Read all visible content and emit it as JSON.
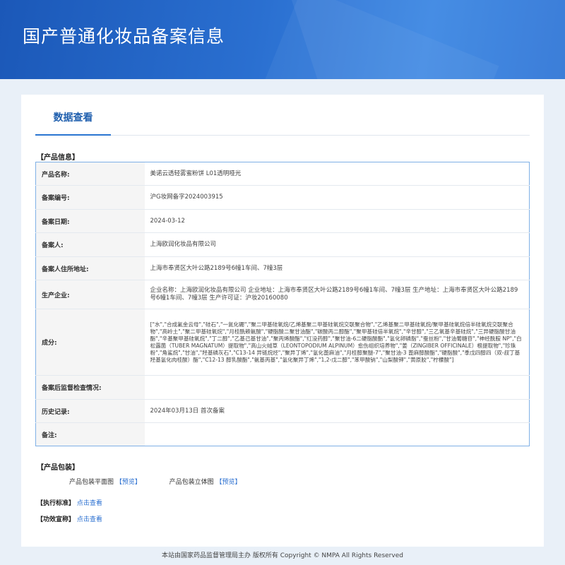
{
  "header": {
    "title": "国产普通化妆品备案信息"
  },
  "tabs": [
    {
      "label": "数据查看"
    }
  ],
  "product_section": {
    "title": "【产品信息】"
  },
  "rows": [
    {
      "label": "产品名称:",
      "value": "美诺云透轻雾蜜粉饼 L01透明哑光"
    },
    {
      "label": "备案编号:",
      "value": "沪G妆网备字2024003915"
    },
    {
      "label": "备案日期:",
      "value": "2024-03-12"
    },
    {
      "label": "备案人:",
      "value": "上海欧润化妆品有限公司"
    },
    {
      "label": "备案人住所地址:",
      "value": "上海市奉贤区大叶公路2189号6幢1车间、7幢3层"
    },
    {
      "label": "生产企业:",
      "value": "企业名称：上海欧润化妆品有限公司 企业地址：上海市奉贤区大叶公路2189号6幢1车间、7幢3层 生产地址：上海市奉贤区大叶公路2189号6幢1车间、7幢3层 生产许可证：沪妆20160080"
    },
    {
      "label": "成分:",
      "value": "[\"水\",\"合成氟金云母\",\"硅石\",\"一氮化硼\",\"聚二甲基硅氧烷/乙烯基聚二甲基硅氧烷交联聚合物\",\"乙烯基聚二甲基硅氧烷/聚甲基硅氧烷倍半硅氧烷交联聚合物\",\"高岭土\",\"聚二甲基硅氧烷\",\"月桂酰赖氨酸\",\"硬脂酸二聚甘油酯\",\"碳酸丙二醇酯\",\"聚甲基硅倍半氧烷\",\"辛甘醇\",\"三乙氧基辛基硅烷\",\"三异硬脂酸甘油酯\",\"辛基聚甲基硅氧烷\",\"丁二醇\",\"乙基己基甘油\",\"聚丙烯酸酯\",\"红没药醇\",\"聚甘油-6二硬脂酸酯\",\"氢化卵磷脂\",\"蚕丝粉\",\"甘油葡糖苷\",\"神经酰胺 NP\",\"白松露菌（TUBER MAGNATUM）提取物\",\"高山火绒草（LEONTOPODIUM ALPINUM）愈伤组织培养物\",\"姜（ZINGIBER OFFICINALE）根提取物\",\"珍珠粉\",\"角鲨烷\",\"甘油\",\"羟基磷灰石\",\"C13-14 异链烷烃\",\"聚异丁烯\",\"氢化蓖麻油\",\"月桂醇聚醚-7\",\"聚甘油-3 蓖麻醇酸酯\",\"硬脂酸\",\"季戊四醇四（双-叔丁基羟基氢化肉桂酸）酯\",\"C12-13 醇乳酸酯\",\"氨基丙基\",\"氢化聚异丁烯\",\"1,2-戊二醇\",\"苯甲酸钠\",\"山梨酸钾\",\"黄原胶\",\"柠檬酸\"]"
    },
    {
      "label": "备案后监督检查情况:",
      "value": ""
    },
    {
      "label": "历史记录:",
      "value": "2024年03月13日 首次备案"
    },
    {
      "label": "备注:",
      "value": ""
    }
  ],
  "package_section": {
    "title": "【产品包装】",
    "flat_label": "产品包装平面图",
    "flat_link": "【预览】",
    "stereo_label": "产品包装立体图",
    "stereo_link": "【预览】"
  },
  "standard": {
    "title": "【执行标准】",
    "link": "点击查看"
  },
  "claims": {
    "title": "【功效宣称】",
    "link": "点击查看"
  },
  "footer": {
    "text": "本站由国家药品监督管理局主办 版权所有 Copyright © NMPA All Rights Reserved"
  },
  "colors": {
    "banner": "#2a6fd0",
    "link": "#2a6fd0",
    "tab_active": "#1f5fae",
    "table_border": "#7fb0e6"
  }
}
